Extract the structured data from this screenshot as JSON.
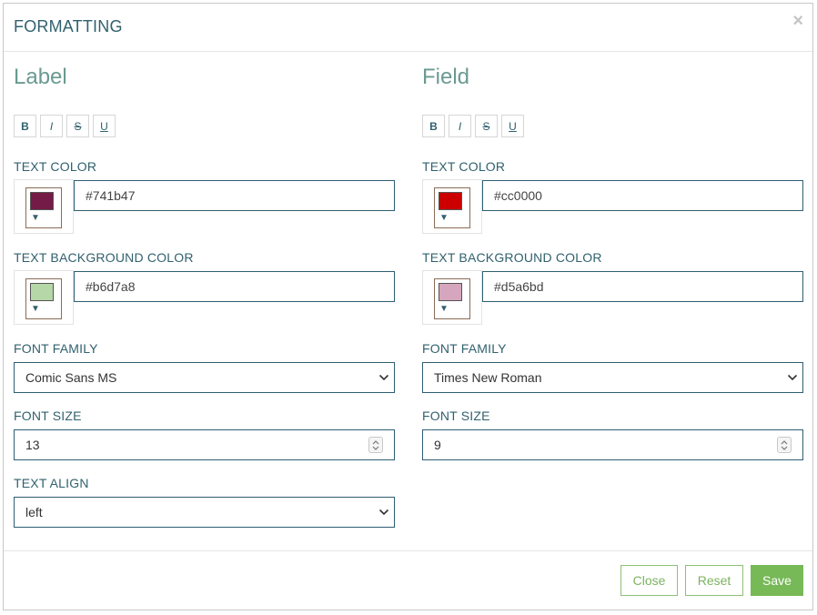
{
  "modal": {
    "title": "FORMATTING",
    "close_glyph": "×"
  },
  "format_buttons": {
    "bold": "B",
    "italic": "I",
    "strike": "S",
    "underline": "U"
  },
  "label": {
    "section_title": "Label",
    "text_color_label": "TEXT COLOR",
    "text_color": "#741b47",
    "text_bg_label": "TEXT BACKGROUND COLOR",
    "text_bg": "#b6d7a8",
    "font_family_label": "FONT FAMILY",
    "font_family": "Comic Sans MS",
    "font_size_label": "FONT SIZE",
    "font_size": "13",
    "text_align_label": "TEXT ALIGN",
    "text_align": "left"
  },
  "field": {
    "section_title": "Field",
    "text_color_label": "TEXT COLOR",
    "text_color": "#cc0000",
    "text_bg_label": "TEXT BACKGROUND COLOR",
    "text_bg": "#d5a6bd",
    "font_family_label": "FONT FAMILY",
    "font_family": "Times New Roman",
    "font_size_label": "FONT SIZE",
    "font_size": "9"
  },
  "footer": {
    "close_label": "Close",
    "reset_label": "Reset",
    "save_label": "Save"
  },
  "colors": {
    "accent_teal": "#31616e",
    "section_green": "#6a9a91",
    "button_green": "#77b857"
  },
  "icons": {
    "dropdown": "chevron-down-icon",
    "spinner": "spinner-icon",
    "swatch_arrow": "caret-down-icon"
  }
}
